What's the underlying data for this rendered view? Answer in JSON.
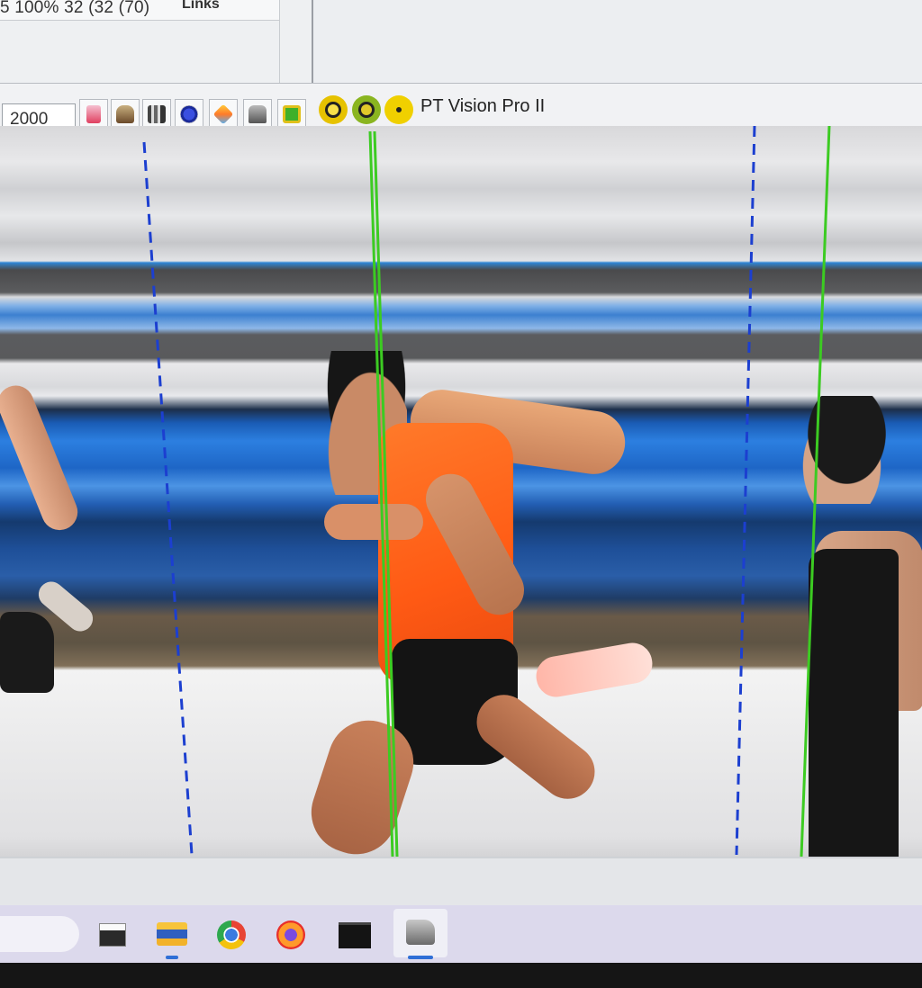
{
  "top_panel": {
    "stats_text": "5 100% 32  (32  (70)",
    "links_label": "Links"
  },
  "toolbar": {
    "frame_input_value": "2000",
    "app_title": "PT Vision Pro II",
    "buttons": [
      {
        "icon": "page-icon"
      },
      {
        "icon": "car-icon"
      },
      {
        "icon": "chart-icon"
      },
      {
        "icon": "target-icon"
      },
      {
        "icon": "diamond-icon"
      },
      {
        "icon": "vehicle-icon"
      },
      {
        "icon": "green-square-icon"
      }
    ],
    "round_buttons": [
      {
        "icon": "yellow-ring-icon",
        "color": "#e6c200"
      },
      {
        "icon": "green-ring-icon",
        "color": "#8ab520"
      },
      {
        "icon": "yellow-dot-icon",
        "color": "#f0d000"
      }
    ]
  },
  "finish_lines": {
    "green_color": "#3ccb22",
    "blue_dashed_color": "#1c3fd0"
  },
  "taskbar": {
    "apps": [
      {
        "icon": "window-icon"
      },
      {
        "icon": "folder-icon"
      },
      {
        "icon": "chrome-icon"
      },
      {
        "icon": "firefox-icon"
      },
      {
        "icon": "terminal-icon"
      },
      {
        "icon": "camera-app-icon"
      }
    ]
  }
}
